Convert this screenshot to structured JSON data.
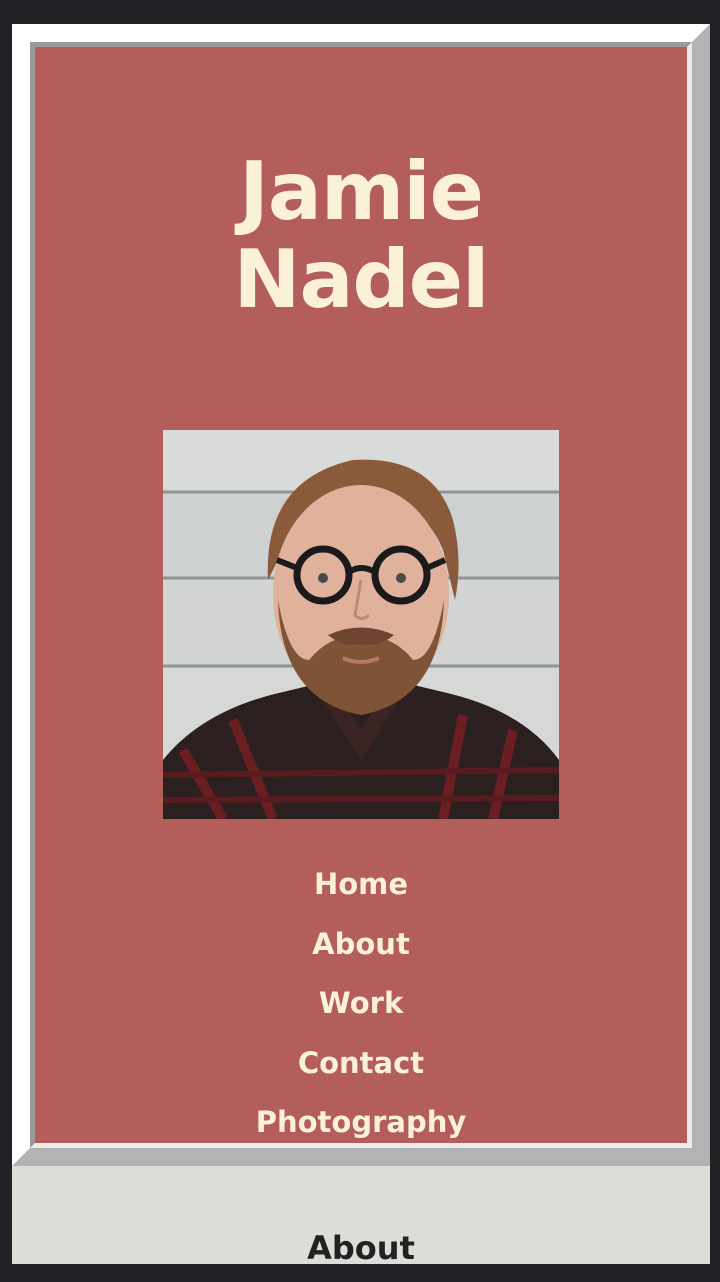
{
  "hero": {
    "name_line1": "Jamie",
    "name_line2": "Nadel",
    "portrait_alt": "Portrait photo of Jamie Nadel"
  },
  "nav": {
    "items": [
      {
        "label": "Home"
      },
      {
        "label": "About"
      },
      {
        "label": "Work"
      },
      {
        "label": "Contact"
      },
      {
        "label": "Photography"
      }
    ]
  },
  "about": {
    "heading": "About"
  },
  "colors": {
    "page_background": "#202124",
    "hero_background": "#b35e5b",
    "hero_text": "#faf1d8",
    "about_background": "#dcdfd9",
    "about_text": "#222222"
  }
}
